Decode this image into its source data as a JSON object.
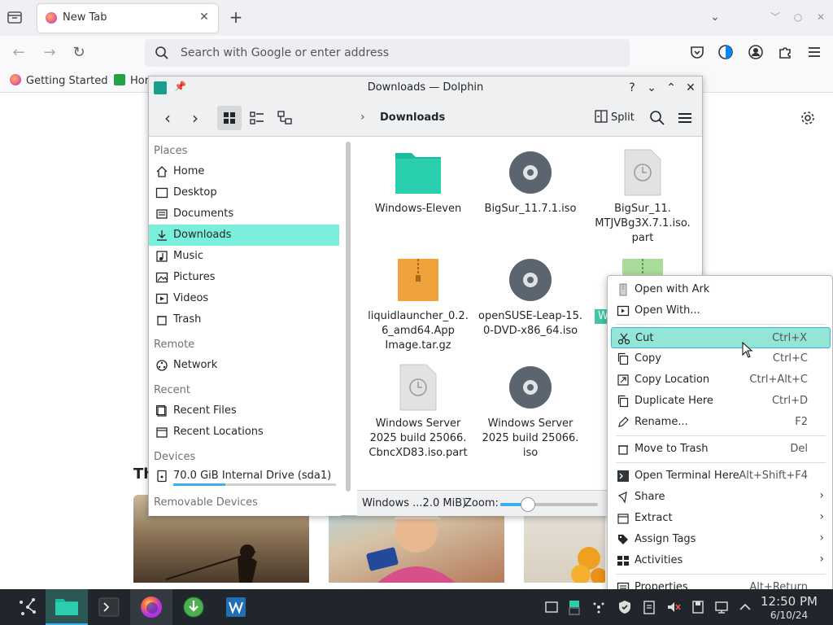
{
  "firefox": {
    "tab_title": "New Tab",
    "search_placeholder": "Search with Google or enter address",
    "bookmarks": [
      "Getting Started",
      "Hor"
    ],
    "section_heading": "Th"
  },
  "dolphin": {
    "window_title": "Downloads — Dolphin",
    "breadcrumb": "Downloads",
    "split_label": "Split",
    "sidebar": {
      "places_header": "Places",
      "places": [
        {
          "label": "Home",
          "icon": "home-icon"
        },
        {
          "label": "Desktop",
          "icon": "desktop-icon"
        },
        {
          "label": "Documents",
          "icon": "documents-icon"
        },
        {
          "label": "Downloads",
          "icon": "downloads-icon"
        },
        {
          "label": "Music",
          "icon": "music-icon"
        },
        {
          "label": "Pictures",
          "icon": "pictures-icon"
        },
        {
          "label": "Videos",
          "icon": "videos-icon"
        },
        {
          "label": "Trash",
          "icon": "trash-icon"
        }
      ],
      "remote_header": "Remote",
      "network_label": "Network",
      "recent_header": "Recent",
      "recent_files_label": "Recent Files",
      "recent_locations_label": "Recent Locations",
      "devices_header": "Devices",
      "drive_label": "70.0 GiB Internal Drive (sda1)",
      "drive_used_fraction": 0.32,
      "removable_header": "Removable Devices"
    },
    "files": [
      {
        "name": "Windows-Eleven",
        "type": "folder"
      },
      {
        "name": "BigSur_11.7.1.iso",
        "type": "disc"
      },
      {
        "name": "BigSur_11.\nMTJVBg3X.7.1.iso.\npart",
        "type": "partial"
      },
      {
        "name": "liquidlauncher_0.2.\n6_amd64.App\nImage.tar.gz",
        "type": "archive"
      },
      {
        "name": "openSUSE-Leap-15.\n0-DVD-x86_64.iso",
        "type": "disc"
      },
      {
        "name": "Windows Server\n2025 build 25066.\nCbncXD83.iso.part",
        "type": "partial"
      },
      {
        "name": "Windows Server\n2025 build 25066.\niso",
        "type": "disc"
      },
      {
        "name": "W",
        "type": "selected"
      }
    ],
    "status_text": "Windows ...2.0 MiB)",
    "zoom_label": "Zoom:",
    "zoom_fraction": 0.28
  },
  "context_menu": {
    "items": [
      {
        "label": "Open with Ark",
        "shortcut": "",
        "icon": "ark-icon",
        "submenu": false
      },
      {
        "label": "Open With...",
        "shortcut": "",
        "icon": "open-with-icon",
        "submenu": false
      },
      {
        "label": "Cut",
        "shortcut": "Ctrl+X",
        "icon": "cut-icon",
        "submenu": false
      },
      {
        "label": "Copy",
        "shortcut": "Ctrl+C",
        "icon": "copy-icon",
        "submenu": false
      },
      {
        "label": "Copy Location",
        "shortcut": "Ctrl+Alt+C",
        "icon": "copy-location-icon",
        "submenu": false
      },
      {
        "label": "Duplicate Here",
        "shortcut": "Ctrl+D",
        "icon": "duplicate-icon",
        "submenu": false
      },
      {
        "label": "Rename...",
        "shortcut": "F2",
        "icon": "rename-icon",
        "submenu": false
      },
      {
        "label": "Move to Trash",
        "shortcut": "Del",
        "icon": "trash-icon",
        "submenu": false
      },
      {
        "label": "Open Terminal Here",
        "shortcut": "Alt+Shift+F4",
        "icon": "terminal-icon",
        "submenu": false
      },
      {
        "label": "Share",
        "shortcut": "",
        "icon": "share-icon",
        "submenu": true
      },
      {
        "label": "Extract",
        "shortcut": "",
        "icon": "extract-icon",
        "submenu": true
      },
      {
        "label": "Assign Tags",
        "shortcut": "",
        "icon": "tag-icon",
        "submenu": true
      },
      {
        "label": "Activities",
        "shortcut": "",
        "icon": "activities-icon",
        "submenu": true
      },
      {
        "label": "Properties",
        "shortcut": "Alt+Return",
        "icon": "properties-icon",
        "submenu": false
      }
    ]
  },
  "taskbar": {
    "time": "12:50 PM",
    "date": "6/10/24"
  },
  "colors": {
    "accent": "#3daee9",
    "selection": "#7af0dc",
    "hover": "#93e6d6",
    "folder": "#1abc9c",
    "taskbar": "#20262b"
  }
}
